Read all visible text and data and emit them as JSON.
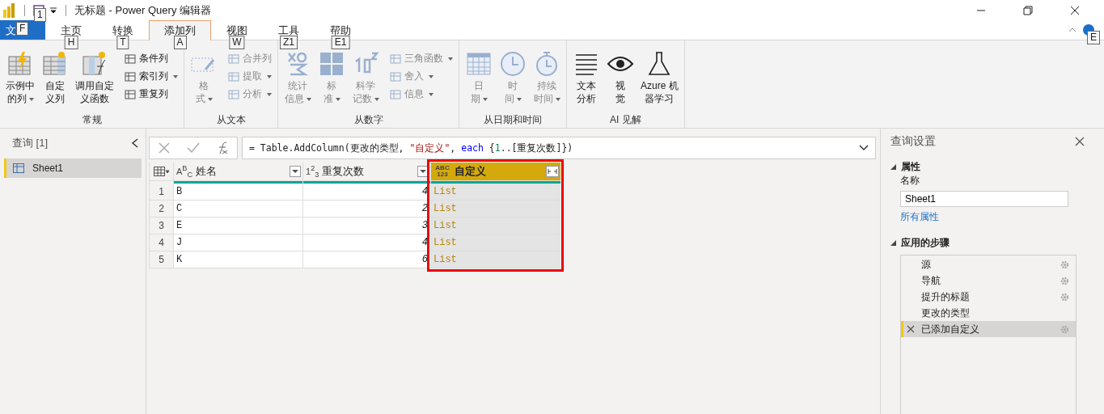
{
  "window": {
    "title": "无标题 - Power Query 编辑器",
    "save_keytip": "1",
    "help_keytip": "E"
  },
  "tabs": [
    {
      "label": "文",
      "kind": "file",
      "selected": false,
      "keytip": "F"
    },
    {
      "label": "主页",
      "kind": "tab",
      "selected": false,
      "keytip": "H"
    },
    {
      "label": "转换",
      "kind": "tab",
      "selected": false,
      "keytip": "T"
    },
    {
      "label": "添加列",
      "kind": "tab",
      "selected": true,
      "keytip": "A"
    },
    {
      "label": "视图",
      "kind": "tab",
      "selected": false,
      "keytip": "W"
    },
    {
      "label": "工具",
      "kind": "tab",
      "selected": false,
      "keytip": "Z1"
    },
    {
      "label": "帮助",
      "kind": "tab",
      "selected": false,
      "keytip": "E1"
    }
  ],
  "ribbon": {
    "groups": [
      {
        "label": "常规",
        "large": [
          {
            "kind": "lightning",
            "lines": [
              "示例中",
              "的列"
            ],
            "dropdown": true,
            "disabled": false
          },
          {
            "kind": "star",
            "lines": [
              "自定",
              "义列"
            ],
            "dropdown": false,
            "disabled": false
          },
          {
            "kind": "fx",
            "lines": [
              "调用自定",
              "义函数"
            ],
            "dropdown": false,
            "disabled": false
          }
        ],
        "small": [
          {
            "label": "条件列",
            "dropdown": false,
            "disabled": false
          },
          {
            "label": "索引列",
            "dropdown": true,
            "disabled": false
          },
          {
            "label": "重复列",
            "dropdown": false,
            "disabled": false
          }
        ]
      },
      {
        "label": "从文本",
        "large": [
          {
            "kind": "abc",
            "lines": [
              "格",
              "式"
            ],
            "dropdown": true,
            "disabled": true
          }
        ],
        "small": [
          {
            "label": "合并列",
            "dropdown": false,
            "disabled": true
          },
          {
            "label": "提取",
            "dropdown": true,
            "disabled": true
          },
          {
            "label": "分析",
            "dropdown": true,
            "disabled": true
          }
        ]
      },
      {
        "label": "从数字",
        "large": [
          {
            "kind": "sigma",
            "lines": [
              "统计",
              "信息"
            ],
            "dropdown": true,
            "disabled": true
          },
          {
            "kind": "calc",
            "lines": [
              "标",
              "准"
            ],
            "dropdown": true,
            "disabled": true
          },
          {
            "kind": "power",
            "lines": [
              "科学",
              "记数"
            ],
            "dropdown": true,
            "disabled": true
          }
        ],
        "small": [
          {
            "label": "三角函数",
            "dropdown": true,
            "disabled": true
          },
          {
            "label": "舍入",
            "dropdown": true,
            "disabled": true
          },
          {
            "label": "信息",
            "dropdown": true,
            "disabled": true
          }
        ]
      },
      {
        "label": "从日期和时间",
        "large": [
          {
            "kind": "calendar",
            "lines": [
              "日",
              "期"
            ],
            "dropdown": true,
            "disabled": true
          },
          {
            "kind": "clock",
            "lines": [
              "时",
              "间"
            ],
            "dropdown": true,
            "disabled": true
          },
          {
            "kind": "stopwatch",
            "lines": [
              "持续",
              "时间"
            ],
            "dropdown": true,
            "disabled": true
          }
        ]
      },
      {
        "label": "AI 见解",
        "large": [
          {
            "kind": "text",
            "lines": [
              "文本",
              "分析"
            ],
            "dropdown": false,
            "disabled": false
          },
          {
            "kind": "eye",
            "lines": [
              "视",
              "觉"
            ],
            "dropdown": false,
            "disabled": false
          },
          {
            "kind": "flask",
            "lines": [
              "Azure 机",
              "器学习"
            ],
            "dropdown": false,
            "disabled": false
          }
        ]
      }
    ]
  },
  "queries_pane": {
    "title": "查询 [1]",
    "items": [
      {
        "label": "Sheet1",
        "selected": true
      }
    ]
  },
  "formula": [
    {
      "kind": "plain",
      "text": "= Table.AddColumn(更改的类型, "
    },
    {
      "kind": "string",
      "text": "\"自定义\""
    },
    {
      "kind": "plain",
      "text": ", "
    },
    {
      "kind": "keyword",
      "text": "each"
    },
    {
      "kind": "plain",
      "text": " {"
    },
    {
      "kind": "number",
      "text": "1"
    },
    {
      "kind": "plain",
      "text": "..[重复次数]})"
    }
  ],
  "table": {
    "columns": [
      {
        "name": "姓名",
        "type_label": "A$^{B}$$_{C}$",
        "kind": "text",
        "selected": false,
        "highlighted": false
      },
      {
        "name": "重复次数",
        "type_label": "1$^{2}$$_{3}$",
        "kind": "number",
        "selected": false,
        "highlighted": false
      },
      {
        "name": "自定义",
        "type_label": "ABC 123",
        "kind": "list",
        "selected": true,
        "highlighted": true
      }
    ],
    "rows": [
      {
        "num": "1",
        "cells": [
          "B",
          "4",
          "List"
        ]
      },
      {
        "num": "2",
        "cells": [
          "C",
          "2",
          "List"
        ]
      },
      {
        "num": "3",
        "cells": [
          "E",
          "3",
          "List"
        ]
      },
      {
        "num": "4",
        "cells": [
          "J",
          "4",
          "List"
        ]
      },
      {
        "num": "5",
        "cells": [
          "K",
          "6",
          "List"
        ]
      }
    ]
  },
  "settings": {
    "title": "查询设置",
    "properties_heading": "属性",
    "name_label": "名称",
    "name_value": "Sheet1",
    "all_properties_link": "所有属性",
    "steps_heading": "应用的步骤",
    "steps": [
      {
        "label": "源",
        "has_settings": true,
        "selected": false
      },
      {
        "label": "导航",
        "has_settings": true,
        "selected": false
      },
      {
        "label": "提升的标题",
        "has_settings": true,
        "selected": false
      },
      {
        "label": "更改的类型",
        "has_settings": false,
        "selected": false
      },
      {
        "label": "已添加自定义",
        "has_settings": true,
        "selected": true
      }
    ]
  }
}
